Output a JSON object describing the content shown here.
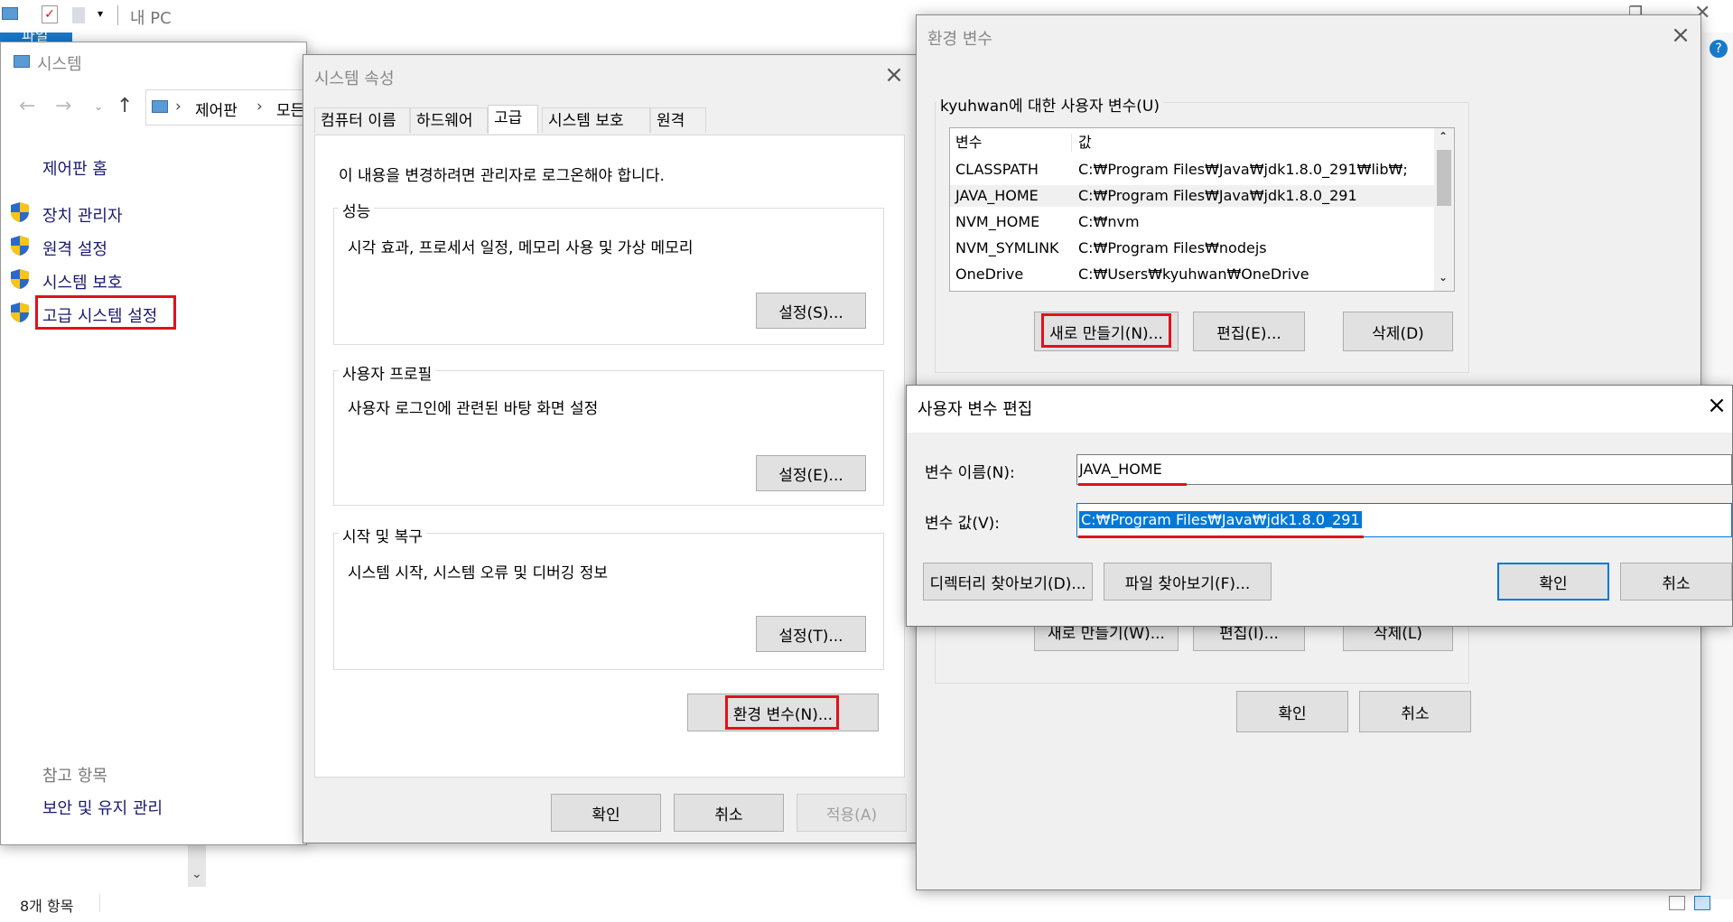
{
  "explorer": {
    "qat_title": "내 PC",
    "file_tab": "파일",
    "window_title": "시스템",
    "breadcrumb": [
      "제어판",
      "모든"
    ],
    "nav_home": "제어판 홈",
    "links": [
      "장치 관리자",
      "원격 설정",
      "시스템 보호",
      "고급 시스템 설정"
    ],
    "see_also": "참고 항목",
    "see_also_link": "보안 및 유지 관리",
    "status": "8개 항목"
  },
  "sysprops": {
    "title": "시스템 속성",
    "tabs": [
      "컴퓨터 이름",
      "하드웨어",
      "고급",
      "시스템 보호",
      "원격"
    ],
    "admin_note": "이 내용을 변경하려면 관리자로 로그온해야 합니다.",
    "perf_label": "성능",
    "perf_desc": "시각 효과, 프로세서 일정, 메모리 사용 및 가상 메모리",
    "perf_btn": "설정(S)...",
    "profile_label": "사용자 프로필",
    "profile_desc": "사용자 로그인에 관련된 바탕 화면 설정",
    "profile_btn": "설정(E)...",
    "startup_label": "시작 및 복구",
    "startup_desc": "시스템 시작, 시스템 오류 및 디버깅 정보",
    "startup_btn": "설정(T)...",
    "env_btn": "환경 변수(N)...",
    "ok": "확인",
    "cancel": "취소",
    "apply": "적용(A)"
  },
  "envvars": {
    "title": "환경 변수",
    "user_group": "kyuhwan에 대한 사용자 변수(U)",
    "col_var": "변수",
    "col_val": "값",
    "rows": [
      {
        "name": "CLASSPATH",
        "value": "C:₩Program Files₩Java₩jdk1.8.0_291₩lib₩;"
      },
      {
        "name": "JAVA_HOME",
        "value": "C:₩Program Files₩Java₩jdk1.8.0_291"
      },
      {
        "name": "NVM_HOME",
        "value": "C:₩nvm"
      },
      {
        "name": "NVM_SYMLINK",
        "value": "C:₩Program Files₩nodejs"
      },
      {
        "name": "OneDrive",
        "value": "C:₩Users₩kyuhwan₩OneDrive"
      }
    ],
    "new_btn": "새로 만들기(N)...",
    "edit_btn": "편집(E)...",
    "delete_btn": "삭제(D)",
    "sys_new_btn": "새로 만들기(W)...",
    "sys_edit_btn": "편집(I)...",
    "sys_delete_btn": "삭제(L)",
    "ok": "확인",
    "cancel": "취소"
  },
  "edituser": {
    "title": "사용자 변수 편집",
    "name_label": "변수 이름(N):",
    "name_value": "JAVA_HOME",
    "value_label": "변수 값(V):",
    "value_value": "C:₩Program Files₩Java₩jdk1.8.0_291",
    "browse_dir": "디렉터리 찾아보기(D)...",
    "browse_file": "파일 찾아보기(F)...",
    "ok": "확인",
    "cancel": "취소"
  },
  "colors": {
    "highlight": "#e0111b",
    "accent": "#0078d7",
    "selection": "#0078d7"
  }
}
